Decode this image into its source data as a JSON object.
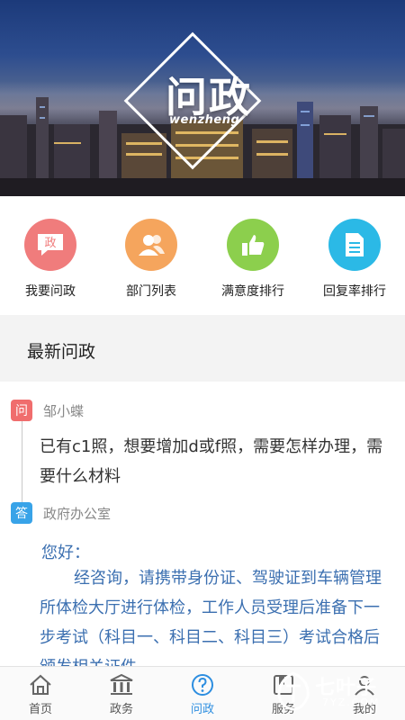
{
  "banner": {
    "logo_title": "问政",
    "logo_sub": "wenzheng"
  },
  "quick_nav": [
    {
      "label": "我要问政",
      "icon": "ask-politics-icon",
      "glyph": "政",
      "color": "#f07c7c"
    },
    {
      "label": "部门列表",
      "icon": "department-list-icon",
      "color": "#f5a55d"
    },
    {
      "label": "满意度排行",
      "icon": "thumbs-up-icon",
      "color": "#8ccf4d"
    },
    {
      "label": "回复率排行",
      "icon": "document-icon",
      "color": "#2bb9e6"
    }
  ],
  "section": {
    "title": "最新问政"
  },
  "post": {
    "q_tag": "问",
    "a_tag": "答",
    "asker": "邹小蝶",
    "question": "已有c1照，想要增加d或f照，需要怎样办理，需要什么材料",
    "office": "政府办公室",
    "greeting": "您好：",
    "answer": "经咨询，请携带身份证、驾驶证到车辆管理所体检大厅进行体检，工作人员受理后准备下一步考试（科目一、科目二、科目三）考试合格后颁发相关证件。"
  },
  "tabbar": [
    {
      "label": "首页",
      "icon": "home-icon"
    },
    {
      "label": "政务",
      "icon": "government-building-icon"
    },
    {
      "label": "问政",
      "icon": "question-icon",
      "active": true
    },
    {
      "label": "服务",
      "icon": "service-icon"
    },
    {
      "label": "我的",
      "icon": "profile-icon"
    }
  ],
  "watermark": {
    "text": "七叶子",
    "domain": "7YZ.COM"
  },
  "colors": {
    "accent": "#2d8ee0",
    "question_tag": "#f06d6d",
    "answer_tag": "#38a3e8",
    "answer_text": "#3b6fb0"
  }
}
